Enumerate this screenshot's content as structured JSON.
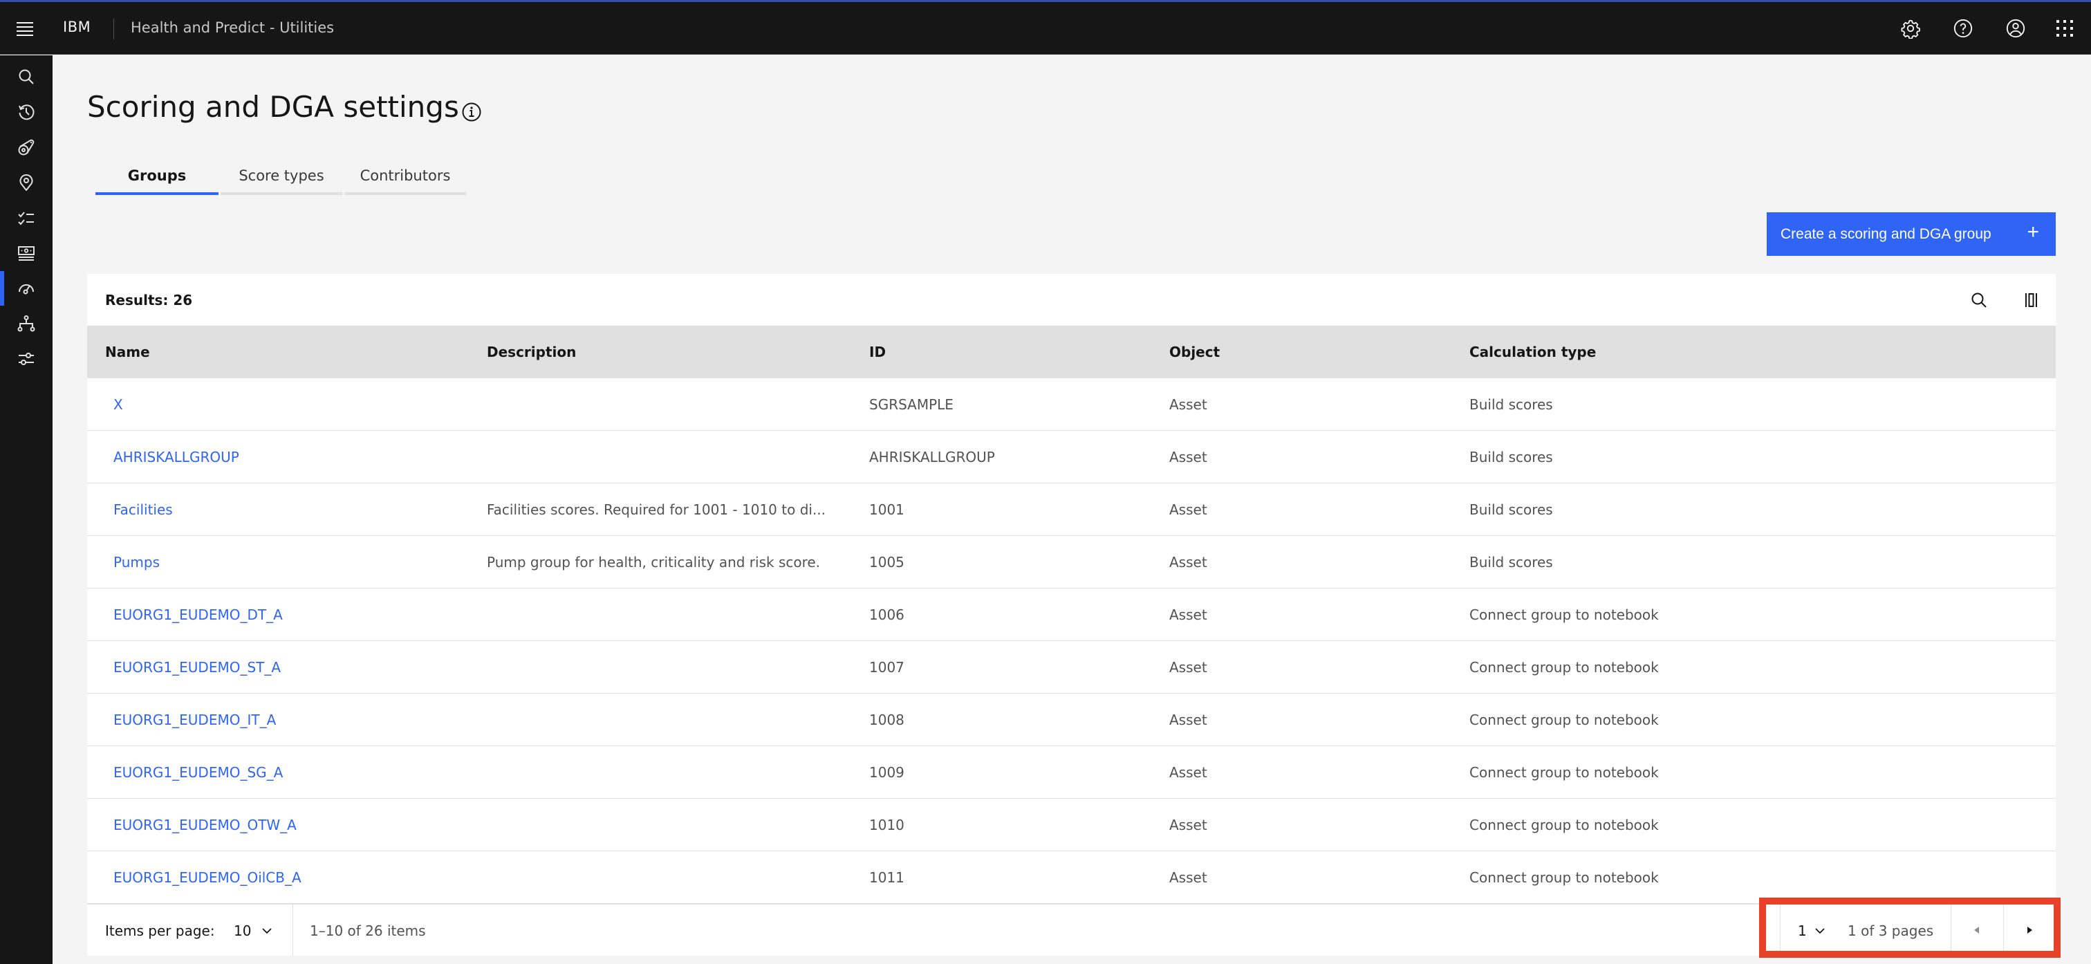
{
  "header": {
    "brand": "IBM",
    "app_title": "Health and Predict - Utilities",
    "icons": [
      "settings-icon",
      "help-icon",
      "user-profile-icon",
      "app-switcher-icon"
    ]
  },
  "sidebar": {
    "items": [
      {
        "name": "search",
        "icon": "search-icon",
        "active": false
      },
      {
        "name": "recent",
        "icon": "history-icon",
        "active": false
      },
      {
        "name": "assets",
        "icon": "asset-icon",
        "active": false
      },
      {
        "name": "locations",
        "icon": "location-icon",
        "active": false
      },
      {
        "name": "checklist",
        "icon": "checklist-icon",
        "active": false
      },
      {
        "name": "financial",
        "icon": "money-icon",
        "active": false
      },
      {
        "name": "scoring",
        "icon": "gauge-icon",
        "active": true
      },
      {
        "name": "hierarchy",
        "icon": "hierarchy-icon",
        "active": false
      },
      {
        "name": "settings",
        "icon": "sliders-icon",
        "active": false
      }
    ]
  },
  "page": {
    "title": "Scoring and DGA settings",
    "tabs": [
      {
        "label": "Groups",
        "active": true
      },
      {
        "label": "Score types",
        "active": false
      },
      {
        "label": "Contributors",
        "active": false
      }
    ],
    "create_button_label": "Create a scoring and DGA group",
    "create_button_icon": "+"
  },
  "table": {
    "results_label": "Results: 26",
    "columns": [
      "Name",
      "Description",
      "ID",
      "Object",
      "Calculation type"
    ],
    "rows": [
      {
        "name": "X",
        "description": "",
        "id": "SGRSAMPLE",
        "object": "Asset",
        "calc": "Build scores"
      },
      {
        "name": "AHRISKALLGROUP",
        "description": "",
        "id": "AHRISKALLGROUP",
        "object": "Asset",
        "calc": "Build scores"
      },
      {
        "name": "Facilities",
        "description": "Facilities scores. Required for 1001 - 1010 to di...",
        "id": "1001",
        "object": "Asset",
        "calc": "Build scores"
      },
      {
        "name": "Pumps",
        "description": "Pump group for health, criticality and risk score.",
        "id": "1005",
        "object": "Asset",
        "calc": "Build scores"
      },
      {
        "name": "EUORG1_EUDEMO_DT_A",
        "description": "",
        "id": "1006",
        "object": "Asset",
        "calc": "Connect group to notebook"
      },
      {
        "name": "EUORG1_EUDEMO_ST_A",
        "description": "",
        "id": "1007",
        "object": "Asset",
        "calc": "Connect group to notebook"
      },
      {
        "name": "EUORG1_EUDEMO_IT_A",
        "description": "",
        "id": "1008",
        "object": "Asset",
        "calc": "Connect group to notebook"
      },
      {
        "name": "EUORG1_EUDEMO_SG_A",
        "description": "",
        "id": "1009",
        "object": "Asset",
        "calc": "Connect group to notebook"
      },
      {
        "name": "EUORG1_EUDEMO_OTW_A",
        "description": "",
        "id": "1010",
        "object": "Asset",
        "calc": "Connect group to notebook"
      },
      {
        "name": "EUORG1_EUDEMO_OilCB_A",
        "description": "",
        "id": "1011",
        "object": "Asset",
        "calc": "Connect group to notebook"
      }
    ]
  },
  "pagination": {
    "items_per_page_label": "Items per page:",
    "items_per_page_value": "10",
    "range_text": "1–10 of 26 items",
    "current_page": "1",
    "pages_text": "1 of 3 pages"
  },
  "colors": {
    "accent": "#2f64f5",
    "header_bg": "#161616",
    "highlight": "#e8412a"
  }
}
